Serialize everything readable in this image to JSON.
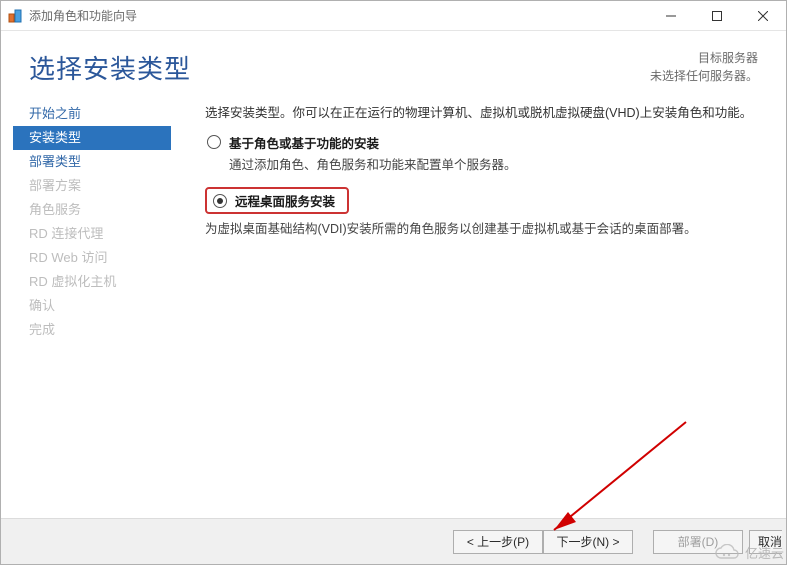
{
  "window_title": "添加角色和功能向导",
  "page_title": "选择安装类型",
  "destination": {
    "label": "目标服务器",
    "status": "未选择任何服务器。"
  },
  "sidebar": {
    "items": [
      {
        "label": "开始之前",
        "state": "link"
      },
      {
        "label": "安装类型",
        "state": "active"
      },
      {
        "label": "部署类型",
        "state": "link"
      },
      {
        "label": "部署方案",
        "state": "disabled"
      },
      {
        "label": "角色服务",
        "state": "disabled"
      },
      {
        "label": "RD 连接代理",
        "state": "disabled"
      },
      {
        "label": "RD Web 访问",
        "state": "disabled"
      },
      {
        "label": "RD 虚拟化主机",
        "state": "disabled"
      },
      {
        "label": "确认",
        "state": "disabled"
      },
      {
        "label": "完成",
        "state": "disabled"
      }
    ]
  },
  "content": {
    "intro": "选择安装类型。你可以在正在运行的物理计算机、虚拟机或脱机虚拟硬盘(VHD)上安装角色和功能。",
    "options": [
      {
        "title": "基于角色或基于功能的安装",
        "desc": "通过添加角色、角色服务和功能来配置单个服务器。",
        "checked": false,
        "highlight": false
      },
      {
        "title": "远程桌面服务安装",
        "desc": "为虚拟桌面基础结构(VDI)安装所需的角色服务以创建基于虚拟机或基于会话的桌面部署。",
        "checked": true,
        "highlight": true
      }
    ]
  },
  "buttons": {
    "prev": "< 上一步(P)",
    "next": "下一步(N) >",
    "deploy": "部署(D)",
    "cancel": "取消"
  },
  "watermark": "亿速云"
}
